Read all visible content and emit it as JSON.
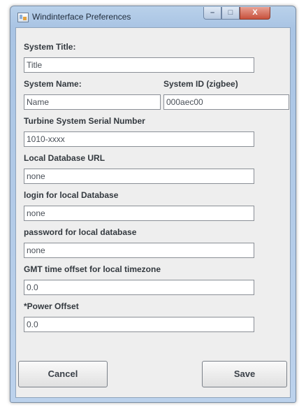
{
  "window": {
    "title": "Windinterface Preferences",
    "controls": {
      "minimize": "–",
      "maximize": "□",
      "close": "X"
    }
  },
  "form": {
    "system_title": {
      "label": "System Title:",
      "value": "Title"
    },
    "system_name": {
      "label": "System Name:",
      "value": "Name"
    },
    "system_id": {
      "label": "System ID (zigbee)",
      "value": "000aec00"
    },
    "serial_number": {
      "label": "Turbine System Serial Number",
      "value": "1010-xxxx"
    },
    "db_url": {
      "label": "Local Database URL",
      "value": "none"
    },
    "db_login": {
      "label": "login for local Database",
      "value": "none"
    },
    "db_password": {
      "label": "password for local database",
      "value": "none"
    },
    "gmt_offset": {
      "label": "GMT time offset for local timezone",
      "value": "0.0"
    },
    "power_offset": {
      "label": "*Power Offset",
      "value": "0.0"
    }
  },
  "buttons": {
    "cancel": "Cancel",
    "save": "Save"
  },
  "colors": {
    "titlebar": "#a9c4e4",
    "client_bg": "#eeeeee",
    "close_button": "#c8513c"
  },
  "icons": {
    "app": "window-app-icon"
  }
}
